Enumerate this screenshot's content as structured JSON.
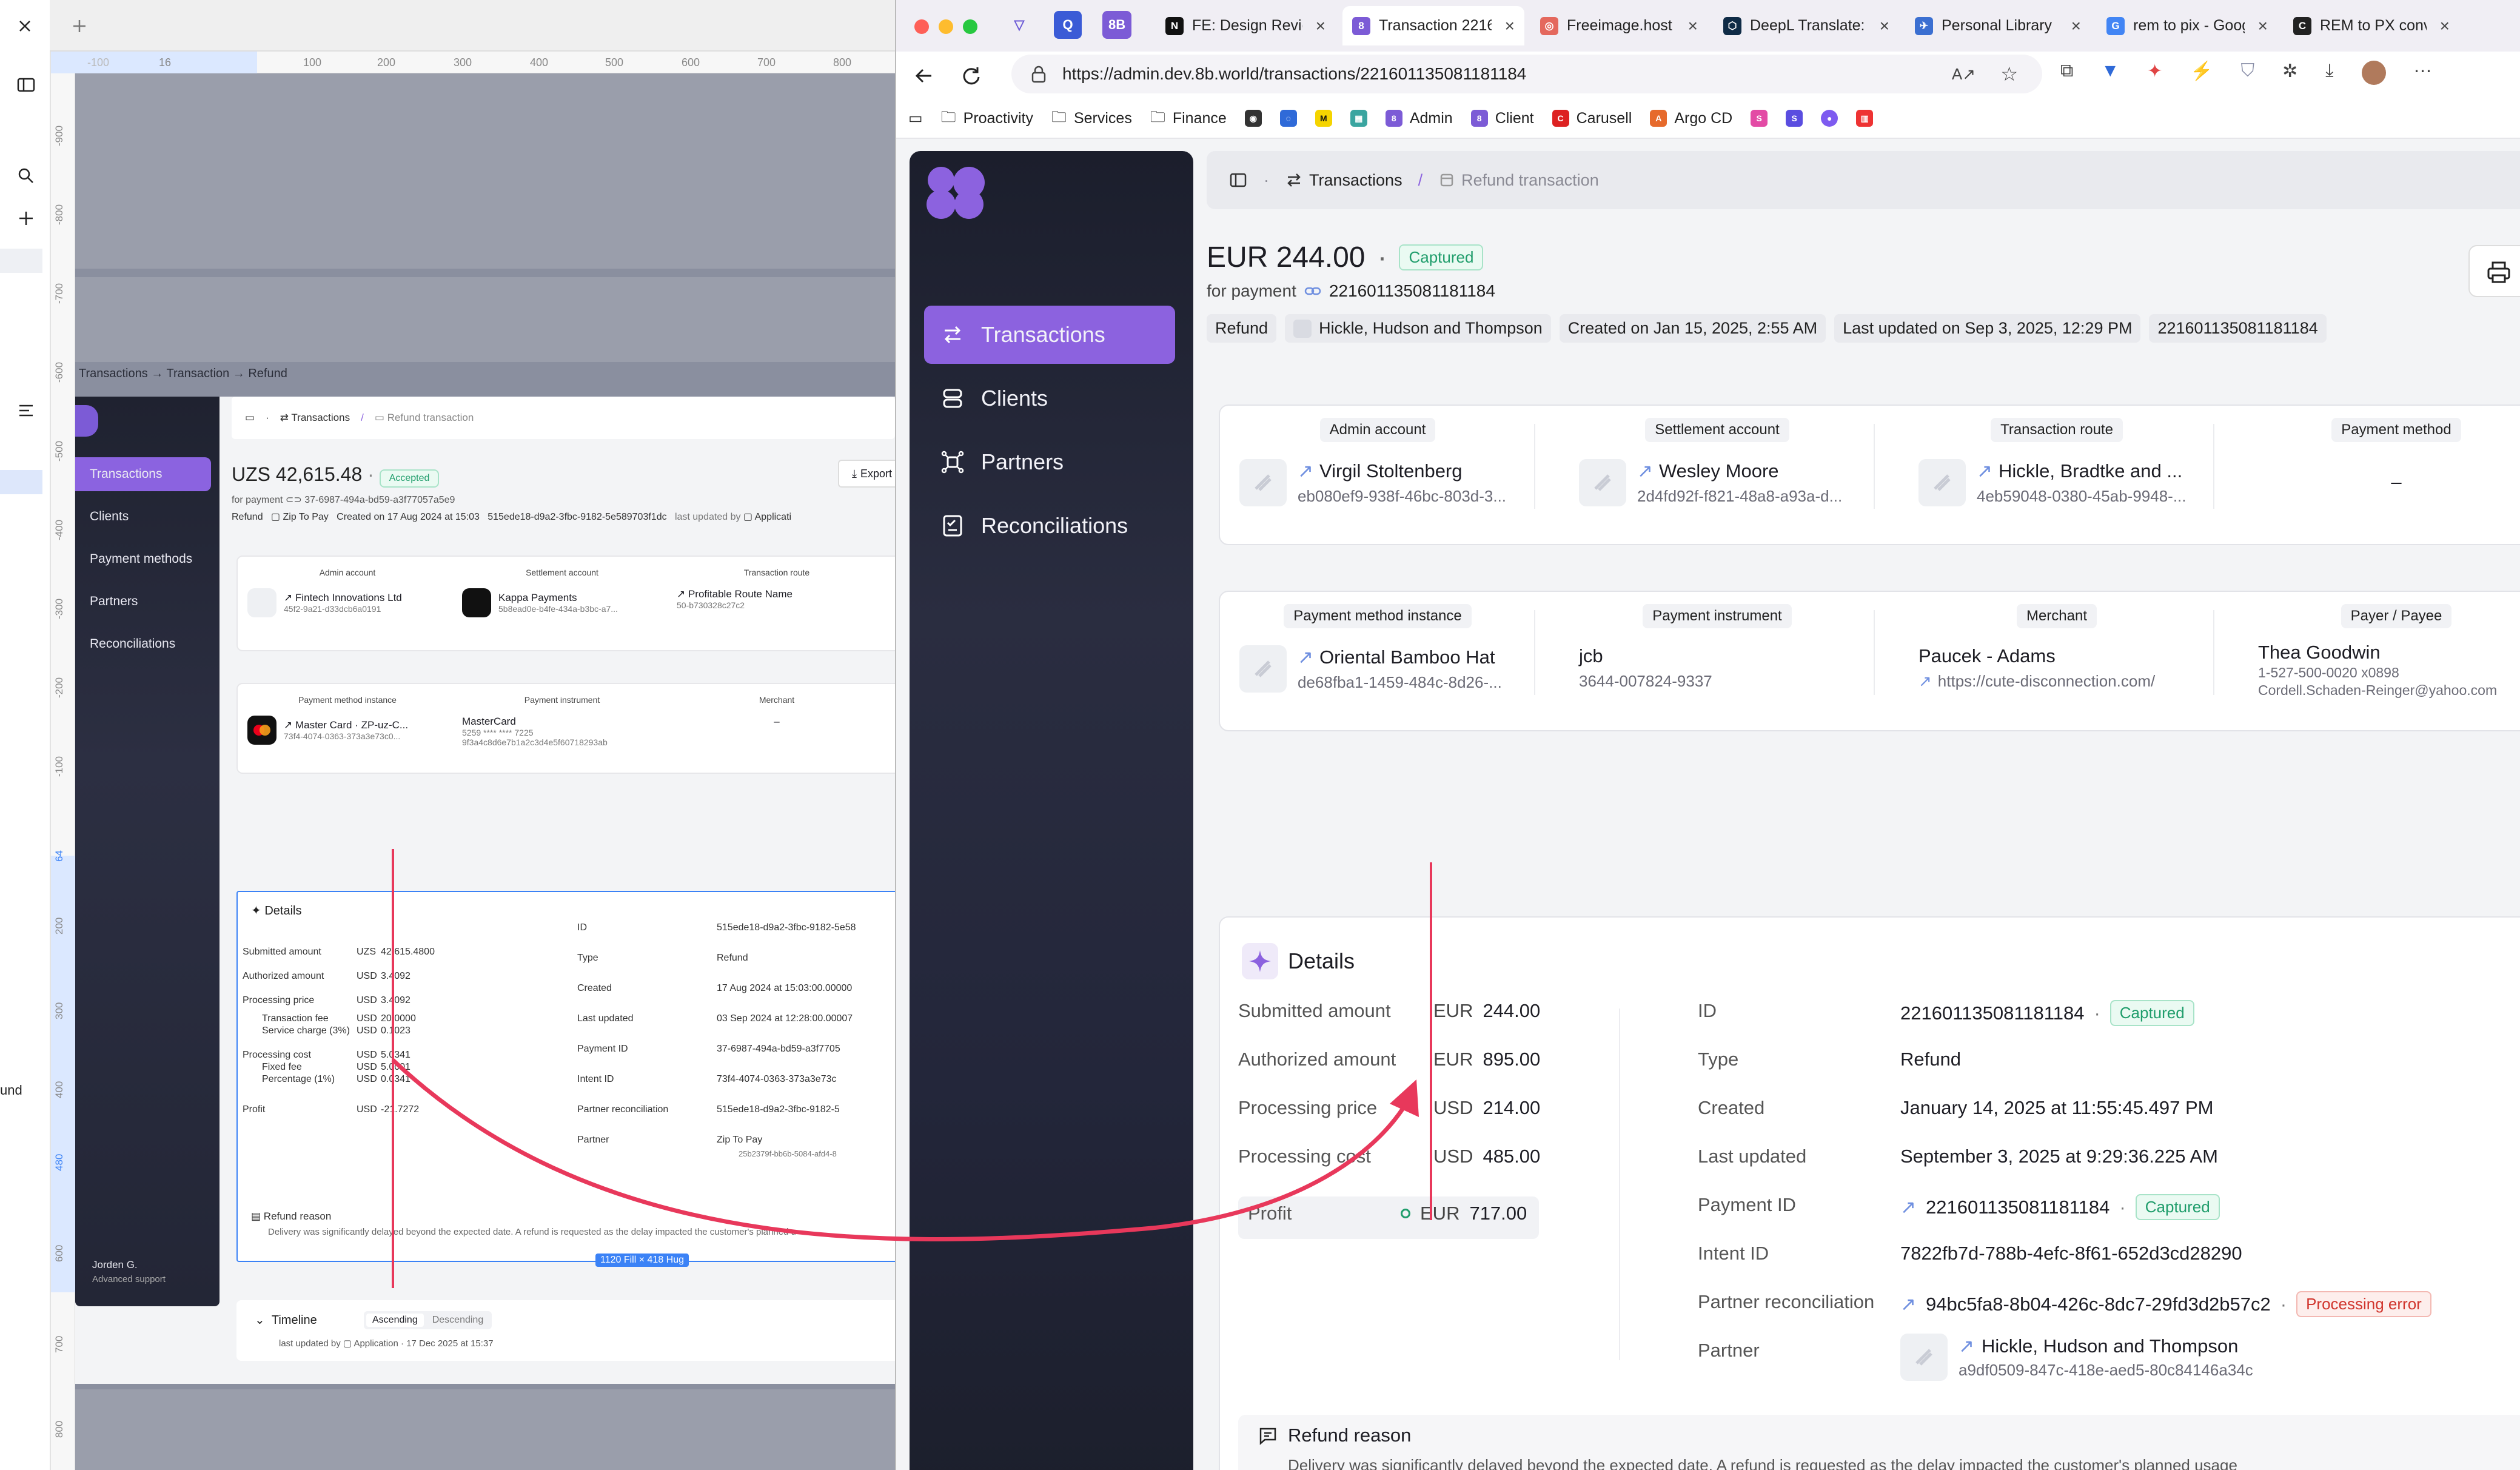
{
  "figma": {
    "breadcrumb": "Transactions → Transaction → Refund",
    "left_label": "und",
    "ruler_top": [
      "-100",
      "16",
      "100",
      "200",
      "300",
      "400",
      "500",
      "600",
      "700",
      "800"
    ],
    "ruler_left": [
      "-900",
      "-800",
      "-700",
      "-600",
      "-500",
      "-400",
      "-300",
      "-200",
      "-100",
      "64",
      "200",
      "300",
      "400",
      "480",
      "600",
      "700",
      "800"
    ],
    "mini": {
      "topbar": {
        "transactions": "Transactions",
        "refund": "Refund transaction"
      },
      "nav": [
        "Transactions",
        "Clients",
        "Payment methods",
        "Partners",
        "Reconciliations"
      ],
      "amount": "UZS 42,615.48",
      "badge": "Accepted",
      "export": "Export",
      "for_payment": "for payment",
      "payment_id": "37-6987-494a-bd59-a3f77057a5e9",
      "meta": [
        "Refund",
        "Zip To Pay",
        "Created on 17 Aug 2024 at 15:03",
        "515ede18-d9a2-3fbc-9182-5e589703f1dc",
        "last updated by",
        "Applicati"
      ],
      "card1": [
        {
          "hd": "Admin account",
          "t1": "Fintech Innovations Ltd",
          "t2": "45f2-9a21-d33dcb6a0191"
        },
        {
          "hd": "Settlement account",
          "t1": "Kappa Payments",
          "t2": "5b8ead0e-b4fe-434a-b3bc-a7..."
        },
        {
          "hd": "Transaction route",
          "t1": "Profitable Route Name",
          "t2": "50-b730328c27c2"
        }
      ],
      "card2": [
        {
          "hd": "Payment method instance",
          "t1": "Master Card · ZP-uz-C...",
          "t2": "73f4-4074-0363-373a3e73c0..."
        },
        {
          "hd": "Payment instrument",
          "t1": "MasterCard",
          "t2": "5259 **** **** 7225",
          "t3": "9f3a4c8d6e7b1a2c3d4e5f60718293ab"
        },
        {
          "hd": "Merchant",
          "t1": "–"
        }
      ],
      "details_title": "Details",
      "rows_left": [
        [
          "Submitted amount",
          "UZS",
          "42,615.4800"
        ],
        [
          "Authorized amount",
          "USD",
          "3.4092"
        ],
        [
          "Processing price",
          "USD",
          "3.4092"
        ],
        [
          "Transaction fee",
          "USD",
          "20.0000"
        ],
        [
          "Service charge (3%)",
          "USD",
          "0.1023"
        ],
        [
          "Processing cost",
          "USD",
          "5.0341"
        ],
        [
          "Fixed fee",
          "USD",
          "5.0001"
        ],
        [
          "Percentage (1%)",
          "USD",
          "0.0341"
        ],
        [
          "Profit",
          "USD",
          "-21.7272"
        ]
      ],
      "rows_right": [
        [
          "ID",
          "515ede18-d9a2-3fbc-9182-5e58"
        ],
        [
          "Type",
          "Refund"
        ],
        [
          "Created",
          "17 Aug 2024 at 15:03:00.00000"
        ],
        [
          "Last updated",
          "03 Sep 2024 at 12:28:00.00007"
        ],
        [
          "Payment ID",
          "37-6987-494a-bd59-a3f7705"
        ],
        [
          "Intent ID",
          "73f4-4074-0363-373a3e73c"
        ],
        [
          "Partner reconciliation",
          "515ede18-d9a2-3fbc-9182-5"
        ],
        [
          "Partner",
          "Zip To Pay",
          "25b2379f-bb6b-5084-afd4-8"
        ]
      ],
      "refund_title": "Refund reason",
      "refund_text": "Delivery was significantly delayed beyond the expected date. A refund is requested as the delay impacted the customer's planned u",
      "size_tag": "1120 Fill × 418 Hug",
      "timeline": "Timeline",
      "asc": "Ascending",
      "desc": "Descending",
      "tl_meta": "last updated by",
      "tl_app": "Application · 17 Dec 2025 at 15:37",
      "user_name": "Jorden G.",
      "user_role": "Advanced support"
    }
  },
  "browser": {
    "tabs": [
      {
        "label": "FE: Design Revie",
        "fav": "N",
        "color": "#111111"
      },
      {
        "label": "Transaction 2216",
        "fav": "8",
        "color": "#7c5bd6"
      },
      {
        "label": "Freeimage.host -",
        "fav": "◎",
        "color": "#e4685d"
      },
      {
        "label": "DeepL Translate:",
        "fav": "⬡",
        "color": "#0f2b46"
      },
      {
        "label": "Personal Library",
        "fav": "✈",
        "color": "#3b6fd1"
      },
      {
        "label": "rem to pix - Goog",
        "fav": "G",
        "color": "#4285f4"
      },
      {
        "label": "REM to PX conve",
        "fav": "C",
        "color": "#222222"
      }
    ],
    "small_tabs": [
      "Q",
      "8B"
    ],
    "url": "https://admin.dev.8b.world/transactions/221601135081181184",
    "bookmarks": [
      "Proactivity",
      "Services",
      "Finance",
      "Admin",
      "Client",
      "Carusell",
      "Argo CD"
    ]
  },
  "app": {
    "nav": [
      "Transactions",
      "Clients",
      "Partners",
      "Reconciliations"
    ],
    "breadcrumb": {
      "section": "Transactions",
      "separator": "/",
      "current": "Refund transaction"
    },
    "currency": "EUR",
    "amount": "244.00",
    "status": "Captured",
    "for_payment_label": "for payment",
    "payment_id": "221601135081181184",
    "meta": {
      "type": "Refund",
      "partner": "Hickle, Hudson and Thompson",
      "created": "Created on Jan 15, 2025, 2:55 AM",
      "updated": "Last updated on Sep 3, 2025, 12:29 PM",
      "id": "221601135081181184"
    },
    "card1": [
      {
        "hd": "Admin account",
        "t1": "Virgil Stoltenberg",
        "t2": "eb080ef9-938f-46bc-803d-3..."
      },
      {
        "hd": "Settlement account",
        "t1": "Wesley Moore",
        "t2": "2d4fd92f-f821-48a8-a93a-d..."
      },
      {
        "hd": "Transaction route",
        "t1": "Hickle, Bradtke and ...",
        "t2": "4eb59048-0380-45ab-9948-..."
      },
      {
        "hd": "Payment method",
        "t1": "–"
      }
    ],
    "card2": [
      {
        "hd": "Payment method instance",
        "t1": "Oriental Bamboo Hat",
        "t2": "de68fba1-1459-484c-8d26-..."
      },
      {
        "hd": "Payment instrument",
        "t1": "jcb",
        "t2": "3644-007824-9337"
      },
      {
        "hd": "Merchant",
        "t1": "Paucek - Adams",
        "t2": "https://cute-disconnection.com/"
      },
      {
        "hd": "Payer / Payee",
        "t1": "Thea Goodwin",
        "t2": "1-527-500-0020 x0898",
        "t3": "Cordell.Schaden-Reinger@yahoo.com"
      }
    ],
    "details": {
      "title": "Details",
      "left": [
        {
          "label": "Submitted amount",
          "cur": "EUR",
          "val": "244.00"
        },
        {
          "label": "Authorized amount",
          "cur": "EUR",
          "val": "895.00"
        },
        {
          "label": "Processing price",
          "cur": "USD",
          "val": "214.00"
        },
        {
          "label": "Processing cost",
          "cur": "USD",
          "val": "485.00"
        },
        {
          "label": "Profit",
          "cur": "EUR",
          "val": "717.00"
        }
      ],
      "right": {
        "id_label": "ID",
        "id": "221601135081181184",
        "id_badge": "Captured",
        "type_label": "Type",
        "type": "Refund",
        "created_label": "Created",
        "created": "January 14, 2025 at 11:55:45.497 PM",
        "updated_label": "Last updated",
        "updated": "September 3, 2025 at 9:29:36.225 AM",
        "payment_label": "Payment ID",
        "payment": "221601135081181184",
        "payment_badge": "Captured",
        "intent_label": "Intent ID",
        "intent": "7822fb7d-788b-4efc-8f61-652d3cd28290",
        "recon_label": "Partner reconciliation",
        "recon": "94bc5fa8-8b04-426c-8dc7-29fd3d2b57c2",
        "recon_badge": "Processing error",
        "partner_label": "Partner",
        "partner": "Hickle, Hudson and Thompson",
        "partner_id": "a9df0509-847c-418e-aed5-80c84146a34c"
      },
      "refund_title": "Refund reason",
      "refund_text": "Delivery was significantly delayed beyond the expected date. A refund is requested as the delay impacted the customer's planned usage"
    }
  },
  "colors": {
    "accent": "#8c62df",
    "captured": "#1f9d6b",
    "error": "#d0342c",
    "annotation": "#e8385b",
    "selection": "#3b82f6"
  }
}
